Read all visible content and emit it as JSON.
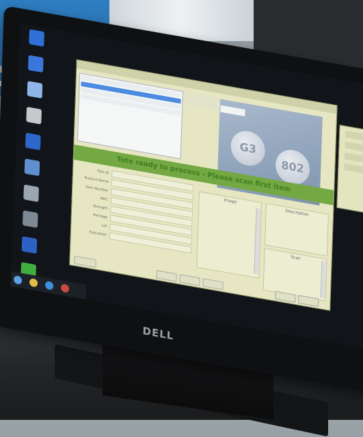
{
  "scene": {
    "brand": "DELL"
  },
  "app": {
    "banner_text": "Tote ready to process - Please scan first item",
    "pill_imprint_left": "G3",
    "pill_imprint_right": "802",
    "compare_label_left": "Image",
    "compare_label_right": "Description",
    "scanned_label": "Scan",
    "form_rows": [
      {
        "label": "Tote ID",
        "value": ""
      },
      {
        "label": "Product Name",
        "value": ""
      },
      {
        "label": "Item Number",
        "value": ""
      },
      {
        "label": "NDC",
        "value": ""
      },
      {
        "label": "Strength",
        "value": ""
      },
      {
        "label": "Package",
        "value": ""
      },
      {
        "label": "Lot",
        "value": ""
      },
      {
        "label": "Expiration",
        "value": ""
      }
    ]
  },
  "colors": {
    "banner": "#73a843",
    "window_bg": "#e6e7c2",
    "selection": "#4c8be0"
  }
}
